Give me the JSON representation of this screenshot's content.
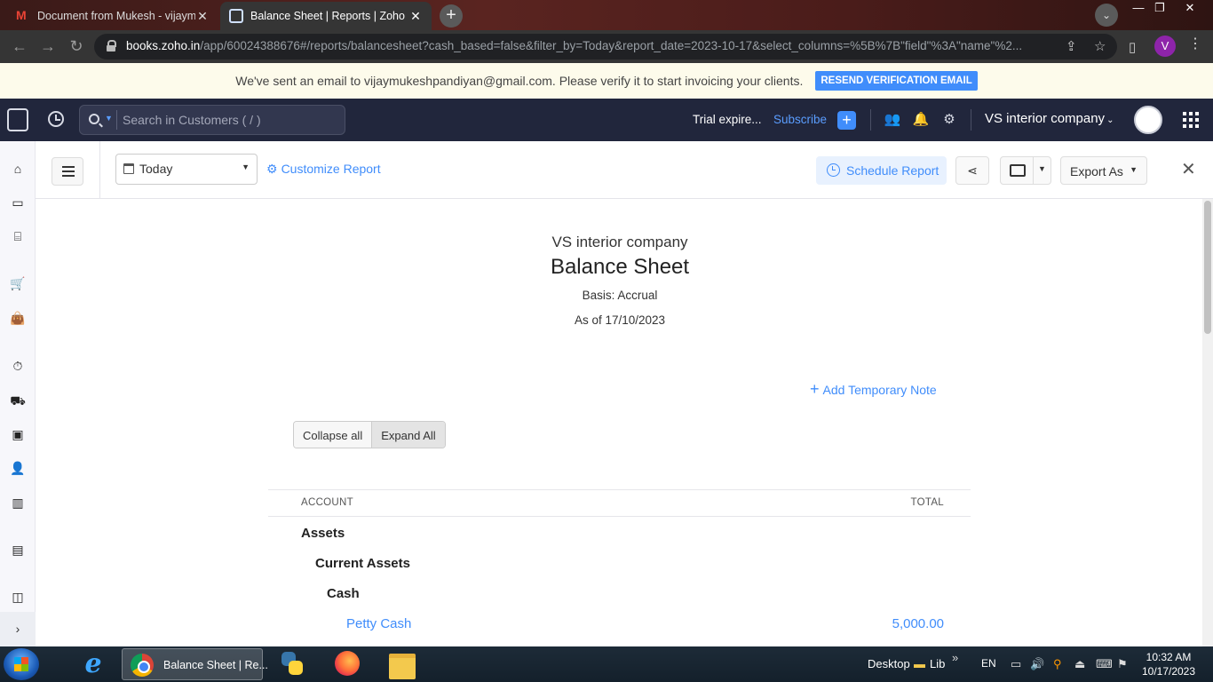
{
  "browser": {
    "tabs": [
      {
        "title": "Document from Mukesh - vijaym",
        "active": false
      },
      {
        "title": "Balance Sheet | Reports | Zoho Bo",
        "active": true
      }
    ],
    "url_host": "books.zoho.in",
    "url_path": "/app/60024388676#/reports/balancesheet?cash_based=false&filter_by=Today&report_date=2023-10-17&select_columns=%5B%7B\"field\"%3A\"name\"%2...",
    "profile_initial": "V"
  },
  "banner": {
    "message": "We've sent an email to vijaymukeshpandiyan@gmail.com. Please verify it to start invoicing your clients.",
    "button_label": "RESEND VERIFICATION EMAIL"
  },
  "header": {
    "search_placeholder": "Search in Customers ( / )",
    "trial_text": "Trial expire...",
    "subscribe_label": "Subscribe",
    "org_name": "VS interior company"
  },
  "toolbar": {
    "date_filter": "Today",
    "customize_label": "Customize Report",
    "schedule_label": "Schedule Report",
    "export_label": "Export As"
  },
  "report": {
    "org_name": "VS interior company",
    "title": "Balance Sheet",
    "basis": "Basis: Accrual",
    "as_of": "As of 17/10/2023",
    "add_note_label": "Add Temporary Note",
    "collapse_label": "Collapse all",
    "expand_label": "Expand All",
    "columns": {
      "account": "ACCOUNT",
      "total": "TOTAL"
    },
    "rows": [
      {
        "label": "Assets",
        "level": 0,
        "amount": ""
      },
      {
        "label": "Current Assets",
        "level": 1,
        "amount": ""
      },
      {
        "label": "Cash",
        "level": 2,
        "amount": ""
      },
      {
        "label": "Petty Cash",
        "level": 3,
        "amount": "5,000.00"
      }
    ]
  },
  "taskbar": {
    "chrome_task_title": "Balance Sheet | Re...",
    "desktop_label": "Desktop",
    "lib_label": "Lib",
    "lang": "EN",
    "time": "10:32 AM",
    "date": "10/17/2023"
  },
  "colors": {
    "accent": "#408dfb",
    "header_bg": "#21263c",
    "banner_bg": "#fdfbeb"
  }
}
